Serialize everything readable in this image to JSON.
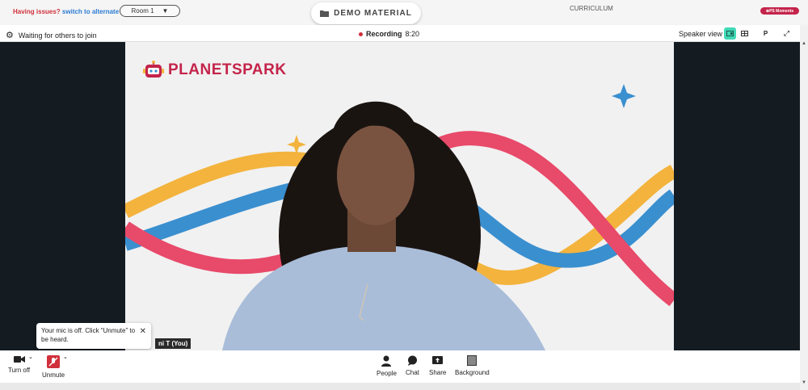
{
  "topbar": {
    "issues_text": "Having issues?",
    "alt_room_link": "switch to alternate room",
    "room_select": "Room 1",
    "demo_material": "DEMO MATERIAL",
    "curriculum": "CURRICULUM",
    "moments_badge": "PS Moments"
  },
  "callbar": {
    "waiting_text": "Waiting for others to join",
    "recording_label": "Recording",
    "recording_time": "8:20",
    "speaker_view": "Speaker view",
    "participant_initial": "P"
  },
  "video": {
    "logo_text": "PLANETSPARK",
    "name_tag": "ni T (You)"
  },
  "toast": {
    "message": "Your mic is off. Click “Unmute” to be heard."
  },
  "controls": {
    "video_label": "Turn off",
    "mic_label": "Unmute",
    "people_label": "People",
    "chat_label": "Chat",
    "share_label": "Share",
    "background_label": "Background"
  },
  "colors": {
    "accent": "#c4244a",
    "wave_red": "#e84a6a",
    "wave_yellow": "#f3b33d",
    "wave_blue": "#3a8fcf",
    "speaker_active": "#3fd9b5"
  }
}
